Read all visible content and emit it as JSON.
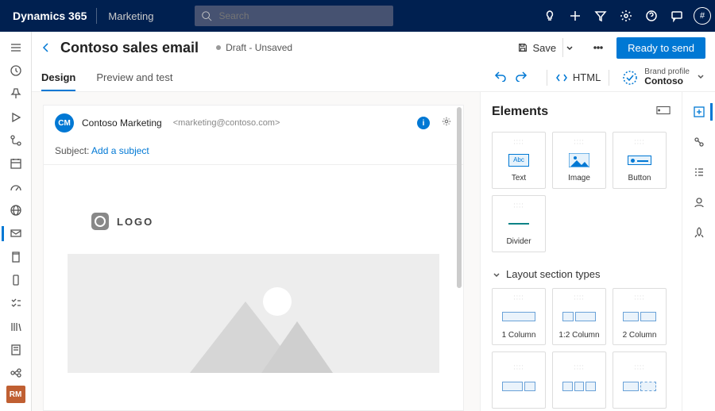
{
  "topbar": {
    "brand": "Dynamics 365",
    "module": "Marketing",
    "search_placeholder": "Search",
    "avatar_glyph": "#"
  },
  "leftrail": {
    "user_initials": "RM"
  },
  "page": {
    "title": "Contoso sales email",
    "status": "Draft - Unsaved",
    "save_label": "Save",
    "primary_action": "Ready to send"
  },
  "tabs": {
    "design": "Design",
    "preview": "Preview and test",
    "html": "HTML",
    "brand_label": "Brand profile",
    "brand_value": "Contoso"
  },
  "email": {
    "sender_initials": "CM",
    "sender_name": "Contoso Marketing",
    "sender_email": "<marketing@contoso.com>",
    "subject_label": "Subject:",
    "subject_placeholder": "Add a subject",
    "logo_text": "LOGO"
  },
  "elements": {
    "panel_title": "Elements",
    "text": "Text",
    "text_glyph": "Abc",
    "image": "Image",
    "button": "Button",
    "divider": "Divider",
    "layout_header": "Layout section types",
    "col1": "1 Column",
    "col12": "1:2 Column",
    "col2": "2 Column"
  }
}
